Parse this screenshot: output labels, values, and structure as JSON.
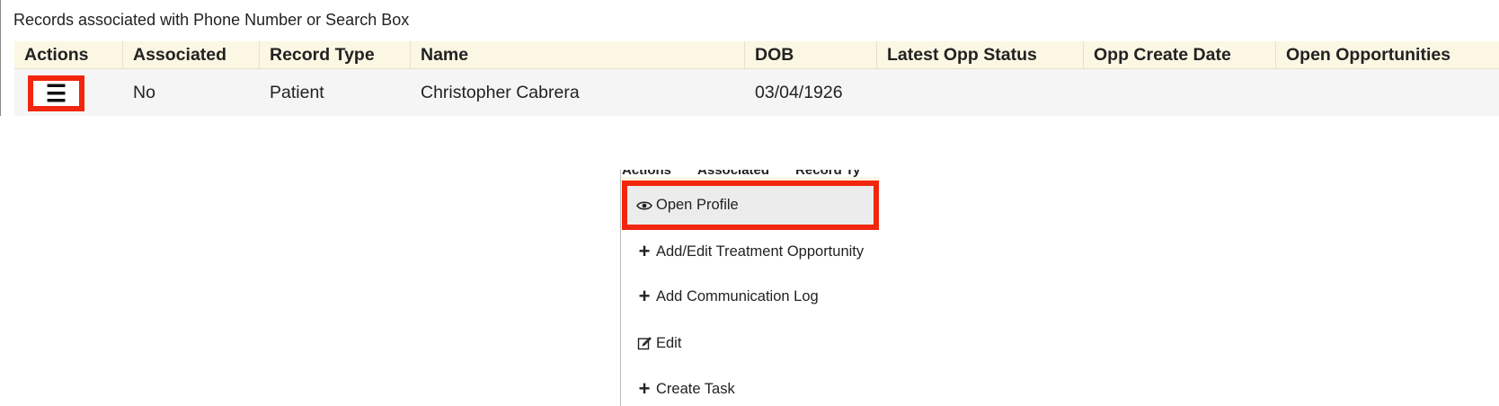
{
  "panel": {
    "title": "Records associated with Phone Number or Search Box"
  },
  "table": {
    "headers": [
      "Actions",
      "Associated",
      "Record Type",
      "Name",
      "DOB",
      "Latest Opp Status",
      "Opp Create Date",
      "Open Opportunities"
    ],
    "rows": [
      {
        "actions_icon": "hamburger-menu-icon",
        "associated": "No",
        "record_type": "Patient",
        "name": "Christopher Cabrera",
        "dob": "03/04/1926",
        "latest_opp_status": "",
        "opp_create_date": "",
        "open_opportunities": ""
      }
    ]
  },
  "dropdown": {
    "ghost_headers": [
      "Actions",
      "Associated",
      "Record Ty"
    ],
    "items": [
      {
        "label": "Open Profile",
        "icon": "eye-icon"
      },
      {
        "label": "Add/Edit Treatment Opportunity",
        "icon": "plus-icon"
      },
      {
        "label": "Add Communication Log",
        "icon": "plus-icon"
      },
      {
        "label": "Edit",
        "icon": "edit-icon"
      },
      {
        "label": "Create Task",
        "icon": "plus-icon"
      }
    ]
  },
  "colors": {
    "highlight": "#f2260e",
    "header_bg": "#fcf7e3",
    "row_bg": "#f5f5f5"
  }
}
